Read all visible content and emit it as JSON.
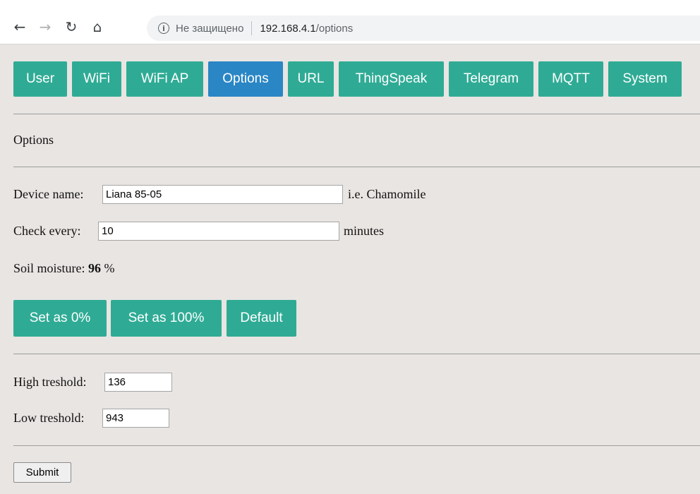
{
  "browser": {
    "security_label": "Не защищено",
    "url_host": "192.168.4.1",
    "url_path": "/options"
  },
  "tabs": [
    {
      "label": "User"
    },
    {
      "label": "WiFi"
    },
    {
      "label": "WiFi AP"
    },
    {
      "label": "Options"
    },
    {
      "label": "URL"
    },
    {
      "label": "ThingSpeak"
    },
    {
      "label": "Telegram"
    },
    {
      "label": "MQTT"
    },
    {
      "label": "System"
    }
  ],
  "section_title": "Options",
  "device_name": {
    "label": "Device name:",
    "value": "Liana 85-05",
    "hint": "i.e. Chamomile"
  },
  "check_every": {
    "label": "Check every:",
    "value": "10",
    "hint": "minutes"
  },
  "soil_moisture": {
    "label": "Soil moisture:",
    "value": "96",
    "unit": "%"
  },
  "calibration": {
    "set_zero": "Set as 0%",
    "set_hundred": "Set as 100%",
    "default": "Default"
  },
  "high_threshold": {
    "label": "High treshold:",
    "value": "136"
  },
  "low_threshold": {
    "label": "Low treshold:",
    "value": "943"
  },
  "submit_label": "Submit",
  "colors": {
    "tab": "#2fab95",
    "tab_active": "#2a86c5",
    "background": "#e9e5e2"
  }
}
